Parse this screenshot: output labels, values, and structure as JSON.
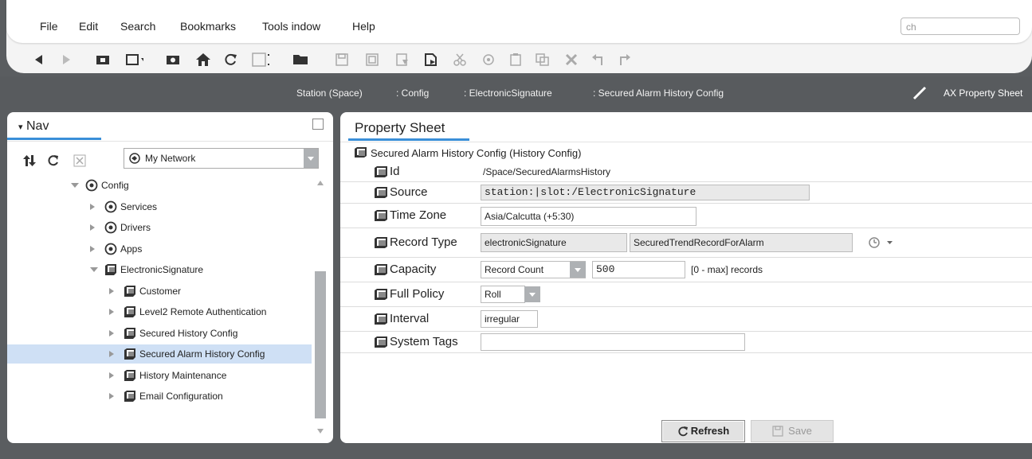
{
  "menu": {
    "file": "File",
    "edit": "Edit",
    "search": "Search",
    "bookmarks": "Bookmarks",
    "tools_window": "Tools indow",
    "help": "Help"
  },
  "search": {
    "value": "ch"
  },
  "path": {
    "station": "Station (Space)",
    "config": ": Config",
    "esig": ": ElectronicSignature",
    "current": ": Secured Alarm History Config",
    "view": "AX Property Sheet"
  },
  "nav": {
    "tab": "Nav",
    "network_select": "My Network",
    "tree": [
      {
        "label": "Config",
        "indent": 1,
        "state": "open",
        "icon": "config-icon"
      },
      {
        "label": "Services",
        "indent": 2,
        "state": "closed",
        "icon": "services-icon"
      },
      {
        "label": "Drivers",
        "indent": 2,
        "state": "closed",
        "icon": "drivers-icon"
      },
      {
        "label": "Apps",
        "indent": 2,
        "state": "closed",
        "icon": "apps-icon"
      },
      {
        "label": "ElectronicSignature",
        "indent": 2,
        "state": "open",
        "icon": "folder-icon"
      },
      {
        "label": "Customer",
        "indent": 3,
        "state": "closed",
        "icon": "folder-icon"
      },
      {
        "label": "Level2 Remote Authentication",
        "indent": 3,
        "state": "closed",
        "icon": "folder-icon"
      },
      {
        "label": "Secured History Config",
        "indent": 3,
        "state": "closed",
        "icon": "folder-icon"
      },
      {
        "label": "Secured Alarm History Config",
        "indent": 3,
        "state": "closed",
        "icon": "folder-icon",
        "selected": true
      },
      {
        "label": "History Maintenance",
        "indent": 3,
        "state": "closed",
        "icon": "folder-icon"
      },
      {
        "label": "Email Configuration",
        "indent": 3,
        "state": "closed",
        "icon": "folder-icon"
      }
    ]
  },
  "sheet": {
    "tab": "Property Sheet",
    "root_label": "Secured Alarm History Config  (History Config)",
    "id_label": "Id",
    "id_value": "/Space/SecuredAlarmsHistory",
    "source_label": "Source",
    "source_value": "station:|slot:/ElectronicSignature",
    "timezone_label": "Time Zone",
    "timezone_value": "Asia/Calcutta (+5:30)",
    "recordtype_label": "Record Type",
    "recordtype_value1": "electronicSignature",
    "recordtype_value2": "SecuredTrendRecordForAlarm",
    "capacity_label": "Capacity",
    "capacity_select": "Record Count",
    "capacity_value": "500",
    "capacity_unit": "[0 - max] records",
    "fullpolicy_label": "Full Policy",
    "fullpolicy_value": "Roll",
    "interval_label": "Interval",
    "interval_value": "irregular",
    "systemtags_label": "System Tags",
    "systemtags_value": "",
    "refresh_label": "Refresh",
    "save_label": "Save"
  }
}
